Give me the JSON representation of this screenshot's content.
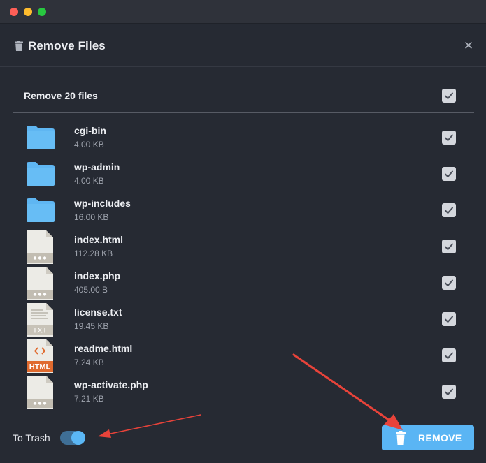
{
  "window": {
    "controls": [
      "close",
      "minimize",
      "zoom"
    ]
  },
  "dialog": {
    "title": "Remove Files",
    "title_icon": "trash-icon",
    "close_icon": "close-icon",
    "close_glyph": "✕"
  },
  "master": {
    "label": "Remove 20 files",
    "checked": true
  },
  "files": [
    {
      "name": "cgi-bin",
      "size": "4.00 KB",
      "icon": "folder-icon",
      "checked": true
    },
    {
      "name": "wp-admin",
      "size": "4.00 KB",
      "icon": "folder-icon",
      "checked": true
    },
    {
      "name": "wp-includes",
      "size": "16.00 KB",
      "icon": "folder-icon",
      "checked": true
    },
    {
      "name": "index.html_",
      "size": "112.28 KB",
      "icon": "generic-file-icon",
      "checked": true
    },
    {
      "name": "index.php",
      "size": "405.00 B",
      "icon": "generic-file-icon",
      "checked": true
    },
    {
      "name": "license.txt",
      "size": "19.45 KB",
      "icon": "txt-file-icon",
      "badge": "TXT",
      "checked": true
    },
    {
      "name": "readme.html",
      "size": "7.24 KB",
      "icon": "html-file-icon",
      "badge": "HTML",
      "checked": true
    },
    {
      "name": "wp-activate.php",
      "size": "7.21 KB",
      "icon": "generic-file-icon",
      "checked": true
    }
  ],
  "footer": {
    "trash_label": "To Trash",
    "trash_enabled": true,
    "remove_label": "REMOVE",
    "remove_icon": "trash-icon"
  },
  "colors": {
    "background": "#262a33",
    "accent": "#5ab5f4",
    "folder": "#5fb6f2",
    "annotation_arrow": "#e8433a",
    "html_badge": "#e06a2e"
  }
}
